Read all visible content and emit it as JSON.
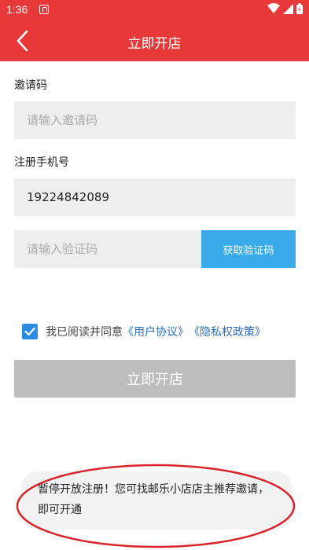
{
  "status_bar": {
    "time": "1:36"
  },
  "nav": {
    "title": "立即开店"
  },
  "form": {
    "invite_label": "邀请码",
    "invite_placeholder": "请输入邀请码",
    "phone_label": "注册手机号",
    "phone_value": "19224842089",
    "code_placeholder": "请输入验证码",
    "get_code_label": "获取验证码"
  },
  "agreement": {
    "checked": true,
    "prefix": "我已阅读并同意",
    "user_agreement": "《用户协议》",
    "privacy_policy": "《隐私权政策》"
  },
  "submit_label": "立即开店",
  "notice_text": "暂停开放注册！您可找邮乐小店店主推荐邀请，即可开通",
  "colors": {
    "brand_red": "#e8393a",
    "button_blue": "#3aabe8",
    "link_blue": "#2b6fc0",
    "disabled_gray": "#bdbdbd",
    "annotation_red": "#d9232a"
  }
}
